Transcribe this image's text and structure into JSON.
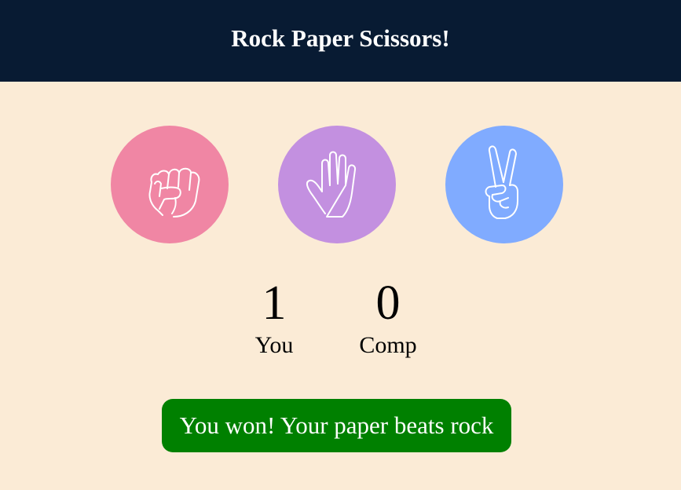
{
  "header": {
    "title": "Rock Paper Scissors!"
  },
  "choices": [
    {
      "name": "rock",
      "icon": "fist-icon",
      "color": "#F086A4"
    },
    {
      "name": "paper",
      "icon": "open-hand-icon",
      "color": "#C390E0"
    },
    {
      "name": "scissors",
      "icon": "victory-hand-icon",
      "color": "#80ABFF"
    }
  ],
  "scoreboard": {
    "player_score": "1",
    "player_label": "You",
    "computer_score": "0",
    "computer_label": "Comp"
  },
  "result": {
    "message": "You won! Your paper beats rock",
    "color": "#008000"
  },
  "colors": {
    "header_bg": "#081B33",
    "page_bg": "#FBEBD6"
  }
}
